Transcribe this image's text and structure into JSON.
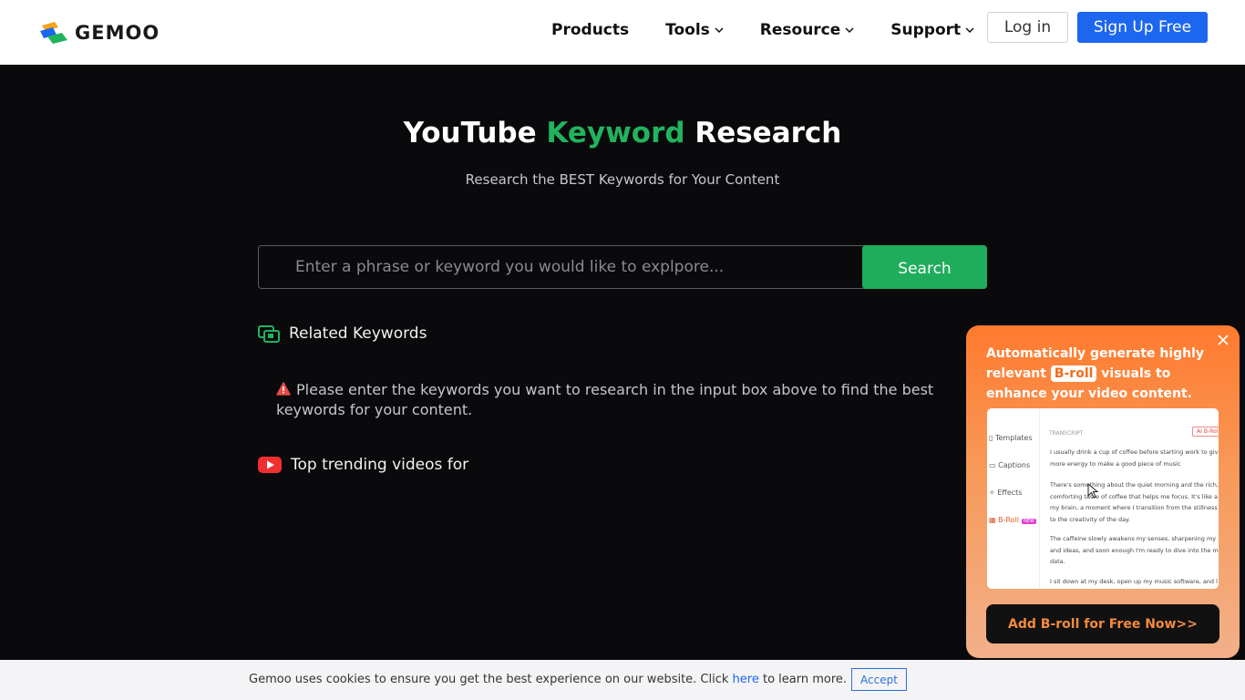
{
  "header": {
    "logo_text": "GEMOO",
    "nav": [
      {
        "label": "Products",
        "has_dropdown": false
      },
      {
        "label": "Tools",
        "has_dropdown": true
      },
      {
        "label": "Resource",
        "has_dropdown": true
      },
      {
        "label": "Support",
        "has_dropdown": true
      }
    ],
    "login_label": "Log in",
    "signup_label": "Sign Up Free"
  },
  "hero": {
    "title_part1": "YouTube ",
    "title_accent": "Keyword",
    "title_part2": " Research",
    "subtitle": "Research the BEST Keywords for Your Content"
  },
  "search": {
    "placeholder": "Enter a phrase or keyword you would like to explpore...",
    "value": "",
    "button_label": "Search"
  },
  "related": {
    "heading": "Related Keywords",
    "notice": "Please enter the keywords you want to research in the input box above to find the best keywords for your content."
  },
  "trending": {
    "heading": "Top trending videos for"
  },
  "popup": {
    "line1": "Automatically generate highly",
    "line2_pre": "relevant ",
    "tag": "B-roll",
    "line2_post": " visuals to",
    "line3": "enhance your video content.",
    "preview": {
      "sidebar": [
        "Templates",
        "Captions",
        "Effects",
        "B-Roll"
      ],
      "new_badge": "NEW",
      "label": "TRANSCRIPT",
      "chip": "AI B-Roll",
      "paragraphs": [
        [
          "I usually drink a cup of coffee before starting work to give",
          "more energy to make a good piece of music"
        ],
        [
          "There's something about the quiet morning and the rich,",
          "comforting taste of coffee that helps me focus. It's like a",
          "my brain, a moment where I transition from the stillness",
          "to the creativity of the day."
        ],
        [
          "The caffeine slowly awakens my senses, sharpening my",
          "and ideas, and soon enough I'm ready to dive into the m",
          "data."
        ],
        [
          "I sit down at my desk, open up my music software, and l"
        ]
      ]
    },
    "cta_label": "Add B-roll for Free Now>>"
  },
  "cookie": {
    "text_pre": "Gemoo uses cookies to ensure you get the best experience on our website. Click ",
    "link": "here",
    "text_post": " to learn more.",
    "accept_label": "Accept"
  },
  "colors": {
    "accent_green": "#21b35e",
    "brand_blue": "#1d66f0",
    "popup_orange": "#ff7a2e"
  }
}
